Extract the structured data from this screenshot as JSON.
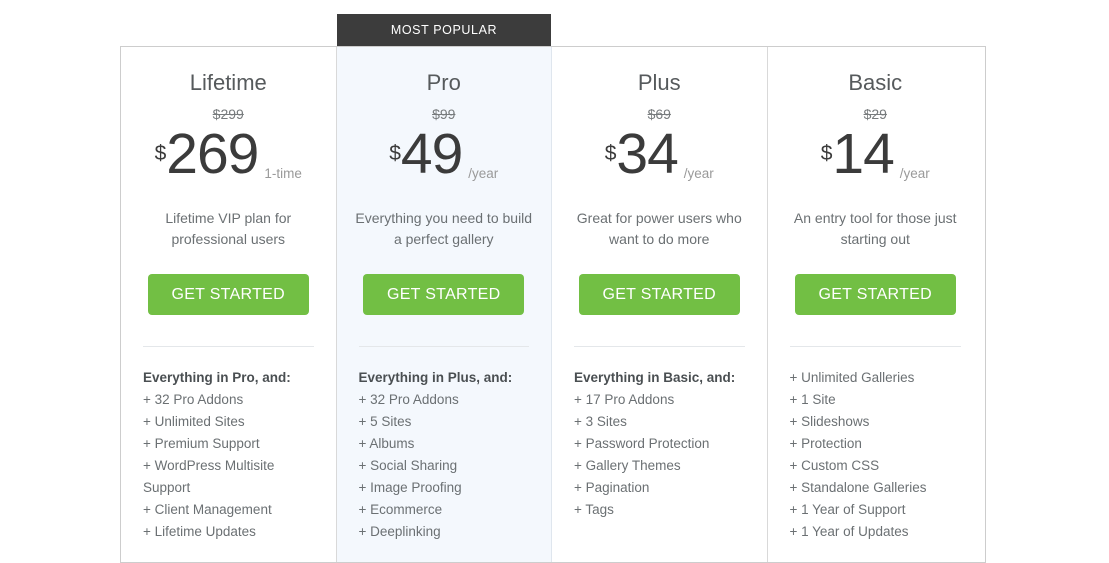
{
  "banner": {
    "label": "MOST POPULAR"
  },
  "plans": [
    {
      "name": "Lifetime",
      "old_price": "$299",
      "currency": "$",
      "amount": "269",
      "period": "1-time",
      "description": "Lifetime VIP plan for professional users",
      "cta": "GET STARTED",
      "featured": false,
      "features_heading": "Everything in Pro, and:",
      "features": [
        "+ 32 Pro Addons",
        "+ Unlimited Sites",
        "+ Premium Support",
        "+ WordPress Multisite Support",
        "+ Client Management",
        "+ Lifetime Updates"
      ]
    },
    {
      "name": "Pro",
      "old_price": "$99",
      "currency": "$",
      "amount": "49",
      "period": "/year",
      "description": "Everything you need to build a perfect gallery",
      "cta": "GET STARTED",
      "featured": true,
      "features_heading": "Everything in Plus, and:",
      "features": [
        "+ 32 Pro Addons",
        "+ 5 Sites",
        "+ Albums",
        "+ Social Sharing",
        "+ Image Proofing",
        "+ Ecommerce",
        "+ Deeplinking"
      ]
    },
    {
      "name": "Plus",
      "old_price": "$69",
      "currency": "$",
      "amount": "34",
      "period": "/year",
      "description": "Great for power users who want to do more",
      "cta": "GET STARTED",
      "featured": false,
      "features_heading": "Everything in Basic, and:",
      "features": [
        "+ 17 Pro Addons",
        "+ 3 Sites",
        "+ Password Protection",
        "+ Gallery Themes",
        "+ Pagination",
        "+ Tags"
      ]
    },
    {
      "name": "Basic",
      "old_price": "$29",
      "currency": "$",
      "amount": "14",
      "period": "/year",
      "description": "An entry tool for those just starting out",
      "cta": "GET STARTED",
      "featured": false,
      "features_heading": "",
      "features": [
        "+ Unlimited Galleries",
        "+ 1 Site",
        "+ Slideshows",
        "+ Protection",
        "+ Custom CSS",
        "+ Standalone Galleries",
        "+ 1 Year of Support",
        "+ 1 Year of Updates"
      ]
    }
  ],
  "colors": {
    "cta_green": "#72bf44",
    "banner_dark": "#3c3c3c",
    "featured_bg": "#f4f8fd",
    "border": "#cdcdcd"
  }
}
